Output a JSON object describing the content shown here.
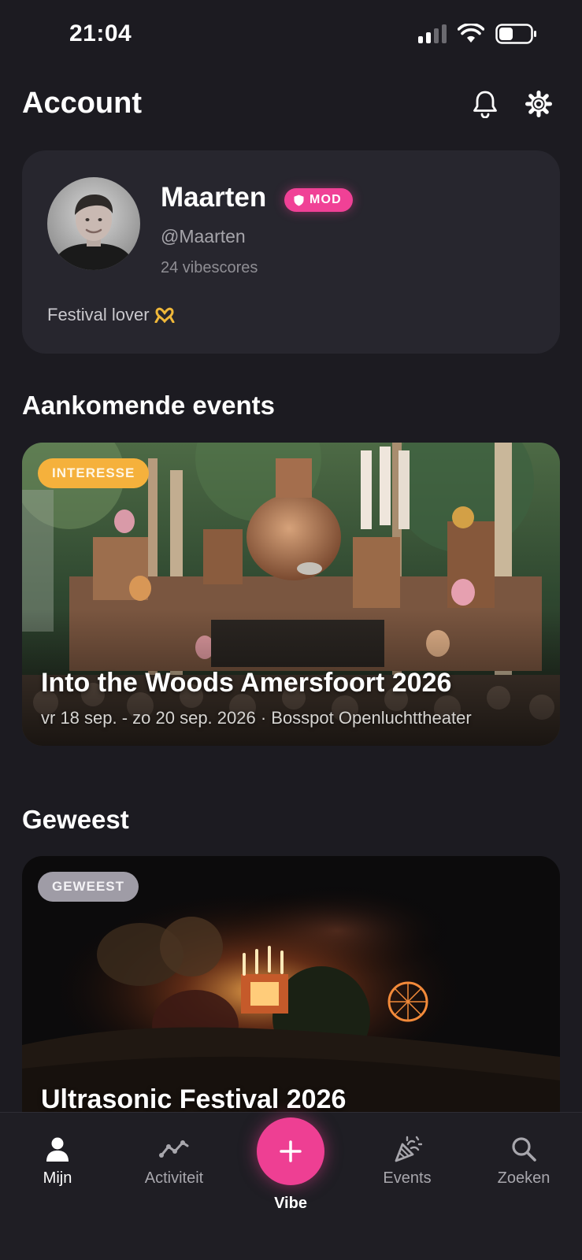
{
  "status_bar": {
    "time": "21:04"
  },
  "header": {
    "title": "Account",
    "notifications_icon": "bell-icon",
    "settings_icon": "gear-icon"
  },
  "profile": {
    "name": "Maarten",
    "badge": "MOD",
    "handle": "@Maarten",
    "vibescores": "24 vibescores",
    "bio": "Festival lover"
  },
  "upcoming": {
    "title": "Aankomende events",
    "events": [
      {
        "status": "INTERESSE",
        "name": "Into the Woods Amersfoort 2026",
        "meta": "vr 18 sep. - zo 20 sep. 2026 · Bosspot Openluchttheater"
      }
    ]
  },
  "past": {
    "title": "Geweest",
    "events": [
      {
        "status": "GEWEEST",
        "name": "Ultrasonic Festival 2026"
      }
    ]
  },
  "tab_bar": {
    "items": [
      {
        "label": "Mijn",
        "icon": "person-icon",
        "active": true
      },
      {
        "label": "Activiteit",
        "icon": "activity-icon",
        "active": false
      },
      {
        "label": "Vibe",
        "icon": "plus-icon",
        "active": false
      },
      {
        "label": "Events",
        "icon": "party-popper-icon",
        "active": false
      },
      {
        "label": "Zoeken",
        "icon": "search-icon",
        "active": false
      }
    ]
  },
  "colors": {
    "accent": "#ee3f93",
    "interest": "#f5b13c",
    "background": "#1c1b21",
    "card": "#27262e"
  }
}
